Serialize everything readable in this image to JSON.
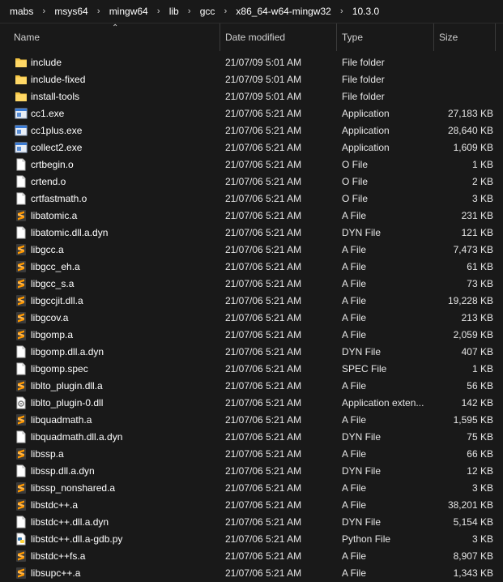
{
  "breadcrumb": [
    "mabs",
    "msys64",
    "mingw64",
    "lib",
    "gcc",
    "x86_64-w64-mingw32",
    "10.3.0"
  ],
  "columns": {
    "name": "Name",
    "date": "Date modified",
    "type": "Type",
    "size": "Size"
  },
  "rows": [
    {
      "name": "include",
      "date": "21/07/09 5:01 AM",
      "type": "File folder",
      "size": "",
      "icon": "folder-icon"
    },
    {
      "name": "include-fixed",
      "date": "21/07/09 5:01 AM",
      "type": "File folder",
      "size": "",
      "icon": "folder-icon"
    },
    {
      "name": "install-tools",
      "date": "21/07/09 5:01 AM",
      "type": "File folder",
      "size": "",
      "icon": "folder-icon"
    },
    {
      "name": "cc1.exe",
      "date": "21/07/06 5:21 AM",
      "type": "Application",
      "size": "27,183 KB",
      "icon": "exe-icon"
    },
    {
      "name": "cc1plus.exe",
      "date": "21/07/06 5:21 AM",
      "type": "Application",
      "size": "28,640 KB",
      "icon": "exe-icon"
    },
    {
      "name": "collect2.exe",
      "date": "21/07/06 5:21 AM",
      "type": "Application",
      "size": "1,609 KB",
      "icon": "exe-icon"
    },
    {
      "name": "crtbegin.o",
      "date": "21/07/06 5:21 AM",
      "type": "O File",
      "size": "1 KB",
      "icon": "file-icon"
    },
    {
      "name": "crtend.o",
      "date": "21/07/06 5:21 AM",
      "type": "O File",
      "size": "2 KB",
      "icon": "file-icon"
    },
    {
      "name": "crtfastmath.o",
      "date": "21/07/06 5:21 AM",
      "type": "O File",
      "size": "3 KB",
      "icon": "file-icon"
    },
    {
      "name": "libatomic.a",
      "date": "21/07/06 5:21 AM",
      "type": "A File",
      "size": "231 KB",
      "icon": "sublime-file-icon"
    },
    {
      "name": "libatomic.dll.a.dyn",
      "date": "21/07/06 5:21 AM",
      "type": "DYN File",
      "size": "121 KB",
      "icon": "file-icon"
    },
    {
      "name": "libgcc.a",
      "date": "21/07/06 5:21 AM",
      "type": "A File",
      "size": "7,473 KB",
      "icon": "sublime-file-icon"
    },
    {
      "name": "libgcc_eh.a",
      "date": "21/07/06 5:21 AM",
      "type": "A File",
      "size": "61 KB",
      "icon": "sublime-file-icon"
    },
    {
      "name": "libgcc_s.a",
      "date": "21/07/06 5:21 AM",
      "type": "A File",
      "size": "73 KB",
      "icon": "sublime-file-icon"
    },
    {
      "name": "libgccjit.dll.a",
      "date": "21/07/06 5:21 AM",
      "type": "A File",
      "size": "19,228 KB",
      "icon": "sublime-file-icon"
    },
    {
      "name": "libgcov.a",
      "date": "21/07/06 5:21 AM",
      "type": "A File",
      "size": "213 KB",
      "icon": "sublime-file-icon"
    },
    {
      "name": "libgomp.a",
      "date": "21/07/06 5:21 AM",
      "type": "A File",
      "size": "2,059 KB",
      "icon": "sublime-file-icon"
    },
    {
      "name": "libgomp.dll.a.dyn",
      "date": "21/07/06 5:21 AM",
      "type": "DYN File",
      "size": "407 KB",
      "icon": "file-icon"
    },
    {
      "name": "libgomp.spec",
      "date": "21/07/06 5:21 AM",
      "type": "SPEC File",
      "size": "1 KB",
      "icon": "file-icon"
    },
    {
      "name": "liblto_plugin.dll.a",
      "date": "21/07/06 5:21 AM",
      "type": "A File",
      "size": "56 KB",
      "icon": "sublime-file-icon"
    },
    {
      "name": "liblto_plugin-0.dll",
      "date": "21/07/06 5:21 AM",
      "type": "Application exten...",
      "size": "142 KB",
      "icon": "dll-icon"
    },
    {
      "name": "libquadmath.a",
      "date": "21/07/06 5:21 AM",
      "type": "A File",
      "size": "1,595 KB",
      "icon": "sublime-file-icon"
    },
    {
      "name": "libquadmath.dll.a.dyn",
      "date": "21/07/06 5:21 AM",
      "type": "DYN File",
      "size": "75 KB",
      "icon": "file-icon"
    },
    {
      "name": "libssp.a",
      "date": "21/07/06 5:21 AM",
      "type": "A File",
      "size": "66 KB",
      "icon": "sublime-file-icon"
    },
    {
      "name": "libssp.dll.a.dyn",
      "date": "21/07/06 5:21 AM",
      "type": "DYN File",
      "size": "12 KB",
      "icon": "file-icon"
    },
    {
      "name": "libssp_nonshared.a",
      "date": "21/07/06 5:21 AM",
      "type": "A File",
      "size": "3 KB",
      "icon": "sublime-file-icon"
    },
    {
      "name": "libstdc++.a",
      "date": "21/07/06 5:21 AM",
      "type": "A File",
      "size": "38,201 KB",
      "icon": "sublime-file-icon"
    },
    {
      "name": "libstdc++.dll.a.dyn",
      "date": "21/07/06 5:21 AM",
      "type": "DYN File",
      "size": "5,154 KB",
      "icon": "file-icon"
    },
    {
      "name": "libstdc++.dll.a-gdb.py",
      "date": "21/07/06 5:21 AM",
      "type": "Python File",
      "size": "3 KB",
      "icon": "python-file-icon"
    },
    {
      "name": "libstdc++fs.a",
      "date": "21/07/06 5:21 AM",
      "type": "A File",
      "size": "8,907 KB",
      "icon": "sublime-file-icon"
    },
    {
      "name": "libsupc++.a",
      "date": "21/07/06 5:21 AM",
      "type": "A File",
      "size": "1,343 KB",
      "icon": "sublime-file-icon"
    }
  ],
  "colors": {
    "background": "#191919",
    "folder": "#f4c542",
    "sublime": "#ff9800",
    "exe": "#3a7bd5"
  }
}
